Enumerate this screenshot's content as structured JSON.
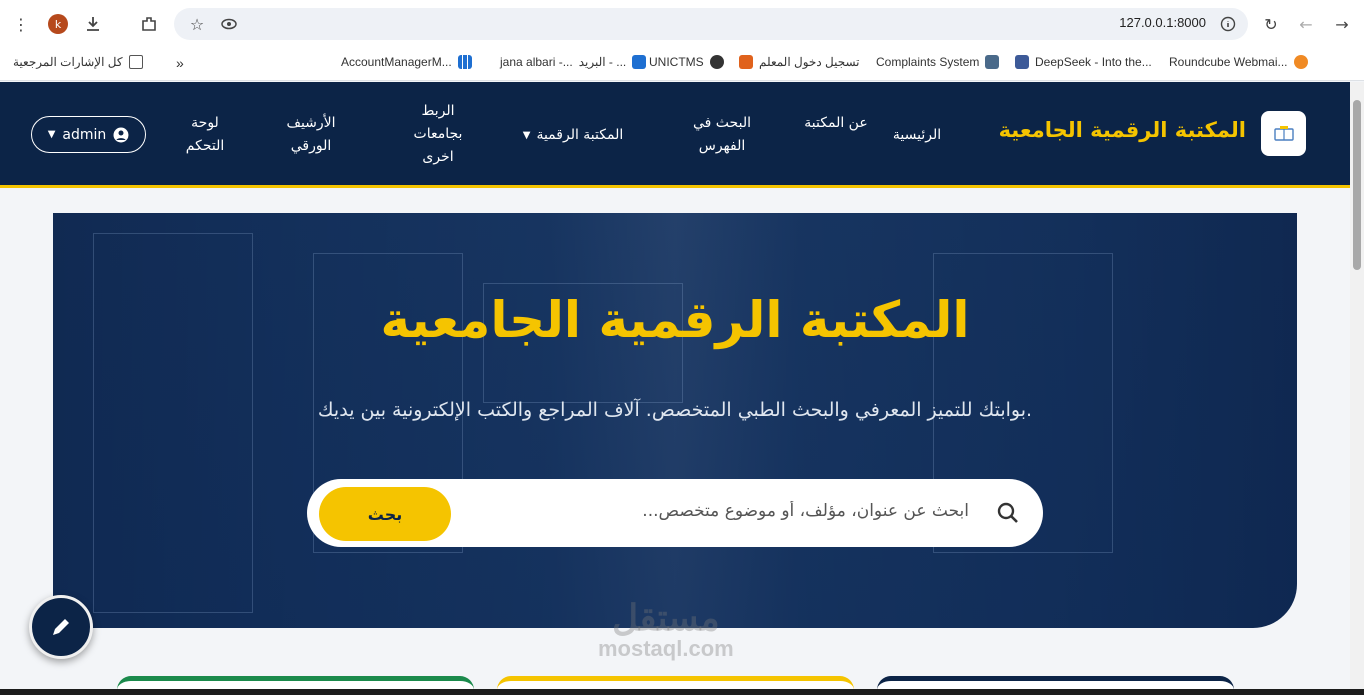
{
  "browser": {
    "profile_initial": "k",
    "url": "127.0.0.1:8000",
    "bookmarks": [
      {
        "label": "Roundcube Webmai...",
        "color": "#f08a24"
      },
      {
        "label": "DeepSeek - Into the...",
        "color": "#3d5a98"
      },
      {
        "label": "Complaints System",
        "color": "#4a6a8a"
      },
      {
        "label": "تسجيل دخول المعلم",
        "color": "#e0621c"
      },
      {
        "label": "UNICTMS",
        "color": "#333333"
      },
      {
        "label": "البريد - ...",
        "color": "#1e6fd1"
      },
      {
        "label": "jana albari -...",
        "color": "#1e6fd1"
      },
      {
        "label": "AccountManagerM...",
        "color": "#1e6fd1"
      }
    ],
    "all_bookmarks_label": "كل الإشارات المرجعية",
    "more_label": "»"
  },
  "header": {
    "brand": "المكتبة الرقمية الجامعية",
    "nav": {
      "home": "الرئيسية",
      "about": "عن المكتبة",
      "catalog": "البحث في الفهرس",
      "digital": "المكتبة الرقمية",
      "links": "الربط بجامعات اخرى",
      "archive": "الأرشيف الورقي",
      "dashboard": "لوحة التحكم"
    },
    "user": "admin"
  },
  "hero": {
    "title": "المكتبة الرقمية الجامعية",
    "subtitle": "بوابتك للتميز المعرفي والبحث الطبي المتخصص. آلاف المراجع والكتب الإلكترونية بين يديك.",
    "search_placeholder": "ابحث عن عنوان، مؤلف، أو موضوع متخصص...",
    "search_button": "بحث"
  },
  "watermark": {
    "brand": "مستقل",
    "domain": "mostaql.com"
  },
  "cards": [
    {
      "accent": "#1b8a4c"
    },
    {
      "accent": "#f5c400"
    },
    {
      "accent": "#0c2447"
    }
  ],
  "colors": {
    "navy": "#0c2447",
    "gold": "#f5c400"
  }
}
